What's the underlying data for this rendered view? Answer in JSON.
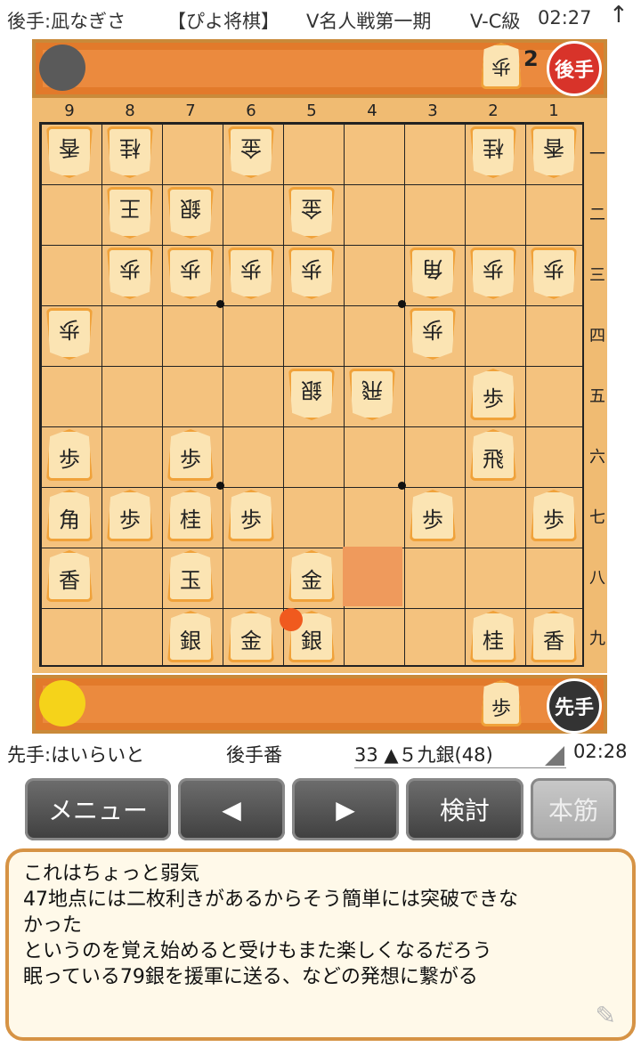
{
  "topbar": {
    "opponent": "後手:凪なぎさ",
    "app": "【ぴよ将棋】",
    "event": "V名人戦第一期",
    "rank": "V-C級",
    "time": "02:27",
    "arrow_icon": "up-arrow-icon"
  },
  "gote_stand": {
    "avatar": "crow-avatar",
    "hand_piece": "歩",
    "hand_count": "2",
    "badge": "後手"
  },
  "sente_stand": {
    "avatar": "chick-avatar",
    "hand_piece": "歩",
    "badge": "先手"
  },
  "board": {
    "files": [
      "9",
      "8",
      "7",
      "6",
      "5",
      "4",
      "3",
      "2",
      "1"
    ],
    "ranks": [
      "一",
      "二",
      "三",
      "四",
      "五",
      "六",
      "七",
      "八",
      "九"
    ],
    "pieces": [
      {
        "file": 9,
        "rank": 1,
        "label": "香",
        "owner": "gote"
      },
      {
        "file": 8,
        "rank": 1,
        "label": "桂",
        "owner": "gote"
      },
      {
        "file": 6,
        "rank": 1,
        "label": "金",
        "owner": "gote"
      },
      {
        "file": 2,
        "rank": 1,
        "label": "桂",
        "owner": "gote"
      },
      {
        "file": 1,
        "rank": 1,
        "label": "香",
        "owner": "gote"
      },
      {
        "file": 8,
        "rank": 2,
        "label": "王",
        "owner": "gote"
      },
      {
        "file": 7,
        "rank": 2,
        "label": "銀",
        "owner": "gote"
      },
      {
        "file": 5,
        "rank": 2,
        "label": "金",
        "owner": "gote"
      },
      {
        "file": 8,
        "rank": 3,
        "label": "歩",
        "owner": "gote"
      },
      {
        "file": 7,
        "rank": 3,
        "label": "歩",
        "owner": "gote"
      },
      {
        "file": 6,
        "rank": 3,
        "label": "歩",
        "owner": "gote"
      },
      {
        "file": 5,
        "rank": 3,
        "label": "歩",
        "owner": "gote"
      },
      {
        "file": 3,
        "rank": 3,
        "label": "角",
        "owner": "gote"
      },
      {
        "file": 2,
        "rank": 3,
        "label": "歩",
        "owner": "gote"
      },
      {
        "file": 1,
        "rank": 3,
        "label": "歩",
        "owner": "gote"
      },
      {
        "file": 9,
        "rank": 4,
        "label": "歩",
        "owner": "gote"
      },
      {
        "file": 3,
        "rank": 4,
        "label": "歩",
        "owner": "gote"
      },
      {
        "file": 5,
        "rank": 5,
        "label": "銀",
        "owner": "gote"
      },
      {
        "file": 4,
        "rank": 5,
        "label": "飛",
        "owner": "gote"
      },
      {
        "file": 2,
        "rank": 5,
        "label": "歩",
        "owner": "sente"
      },
      {
        "file": 9,
        "rank": 6,
        "label": "歩",
        "owner": "sente"
      },
      {
        "file": 7,
        "rank": 6,
        "label": "歩",
        "owner": "sente"
      },
      {
        "file": 2,
        "rank": 6,
        "label": "飛",
        "owner": "sente"
      },
      {
        "file": 9,
        "rank": 7,
        "label": "角",
        "owner": "sente"
      },
      {
        "file": 8,
        "rank": 7,
        "label": "歩",
        "owner": "sente"
      },
      {
        "file": 7,
        "rank": 7,
        "label": "桂",
        "owner": "sente"
      },
      {
        "file": 6,
        "rank": 7,
        "label": "歩",
        "owner": "sente"
      },
      {
        "file": 3,
        "rank": 7,
        "label": "歩",
        "owner": "sente"
      },
      {
        "file": 1,
        "rank": 7,
        "label": "歩",
        "owner": "sente"
      },
      {
        "file": 9,
        "rank": 8,
        "label": "香",
        "owner": "sente"
      },
      {
        "file": 7,
        "rank": 8,
        "label": "玉",
        "owner": "sente"
      },
      {
        "file": 5,
        "rank": 8,
        "label": "金",
        "owner": "sente"
      },
      {
        "file": 7,
        "rank": 9,
        "label": "銀",
        "owner": "sente"
      },
      {
        "file": 6,
        "rank": 9,
        "label": "金",
        "owner": "sente"
      },
      {
        "file": 5,
        "rank": 9,
        "label": "銀",
        "owner": "sente"
      },
      {
        "file": 2,
        "rank": 9,
        "label": "桂",
        "owner": "sente"
      },
      {
        "file": 1,
        "rank": 9,
        "label": "香",
        "owner": "sente"
      }
    ],
    "highlight_from": {
      "file": 4,
      "rank": 8
    },
    "last_move_to": {
      "file": 5,
      "rank": 9
    }
  },
  "status": {
    "sente_name": "先手:はいらいと",
    "turn": "後手番",
    "move": "33 ▲５九銀(48)",
    "time": "02:28"
  },
  "buttons": {
    "menu": "メニュー",
    "prev": "◀",
    "next": "▶",
    "analyze": "検討",
    "mainline": "本筋"
  },
  "comment": {
    "lines": [
      "これはちょっと弱気",
      "47地点には二枚利きがあるからそう簡単には突破できな",
      "かった",
      "というのを覚え始めると受けもまた楽しくなるだろう",
      "眠っている79銀を援軍に送る、などの発想に繋がる"
    ],
    "edit_icon": "pencil-icon"
  },
  "colors": {
    "board": "#f4c27e",
    "stand": "#eb8a3e",
    "highlight": "#ef9a5c",
    "piece_border": "#f0a23a"
  }
}
